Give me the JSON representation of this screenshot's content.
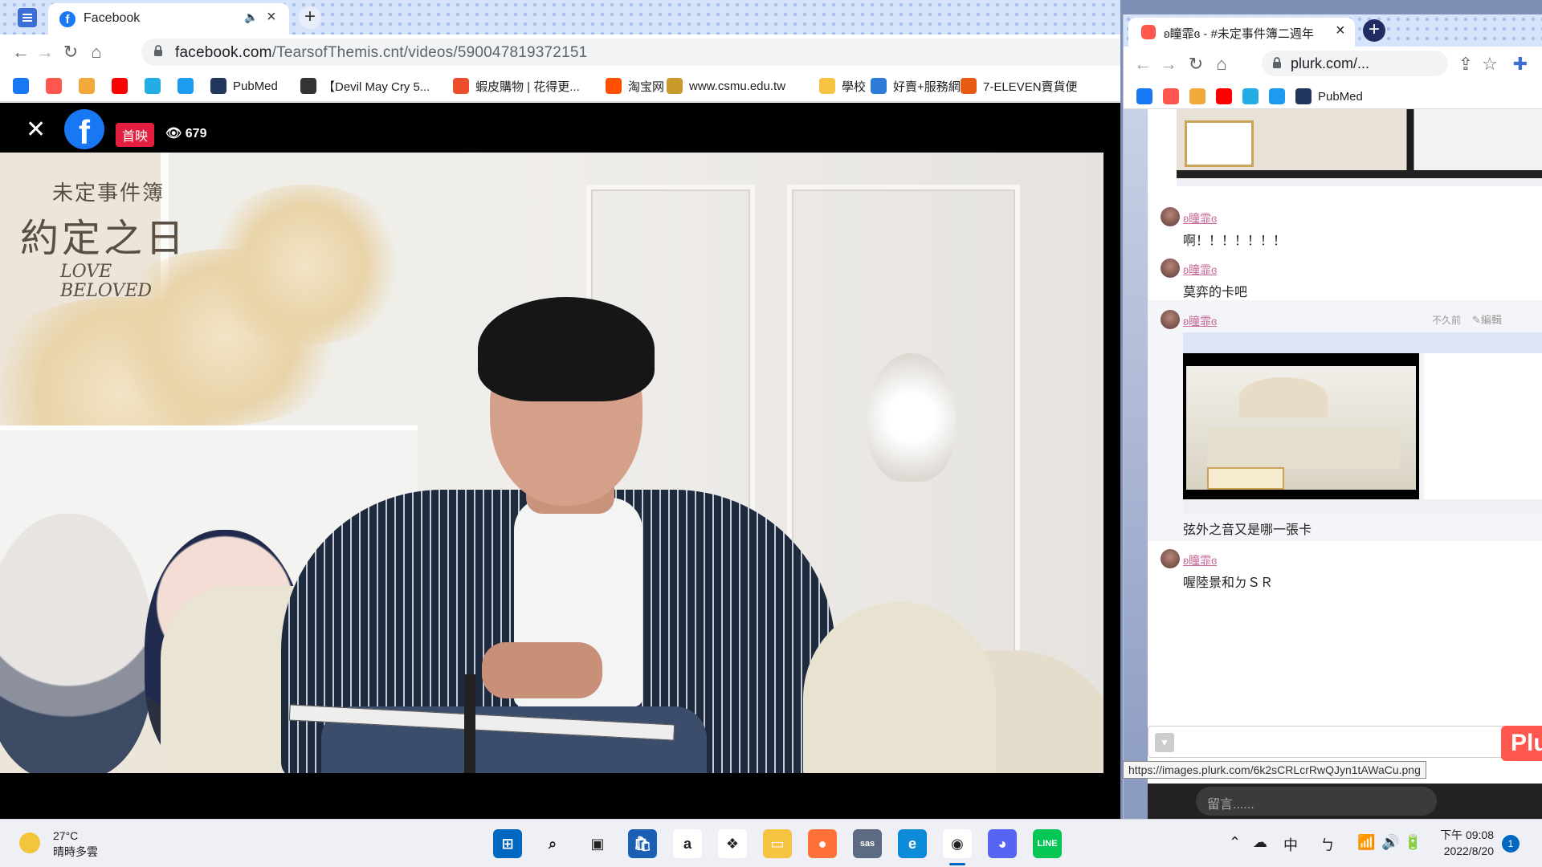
{
  "main_browser": {
    "tab": {
      "title": "Facebook"
    },
    "url": {
      "host": "facebook.com",
      "path": "/TearsofThemis.cnt/videos/590047819372151"
    },
    "bookmarks": [
      {
        "label": "",
        "icon": "facebook-icon",
        "color": "#1877f2"
      },
      {
        "label": "",
        "icon": "plurk-icon",
        "color": "#ff574d"
      },
      {
        "label": "",
        "icon": "orange-square-icon",
        "color": "#f2a93b"
      },
      {
        "label": "",
        "icon": "youtube-icon",
        "color": "#ff0000"
      },
      {
        "label": "",
        "icon": "bilibili-icon",
        "color": "#23ade5"
      },
      {
        "label": "",
        "icon": "twitter-icon",
        "color": "#1d9bf0"
      },
      {
        "label": "PubMed",
        "icon": "pubmed-icon",
        "color": "#20365c"
      },
      {
        "label": "【Devil May Cry 5...",
        "icon": "dmc-icon",
        "color": "#333333"
      },
      {
        "label": "蝦皮購物 | 花得更...",
        "icon": "shopee-icon",
        "color": "#ee4d2d"
      },
      {
        "label": "淘宝网",
        "icon": "taobao-icon",
        "color": "#ff5000"
      },
      {
        "label": "www.csmu.edu.tw",
        "icon": "csmu-icon",
        "color": "#c89a2c"
      },
      {
        "label": "學校",
        "icon": "folder-icon",
        "color": "#f6c342"
      },
      {
        "label": "好賣+服務網",
        "icon": "haomai-icon",
        "color": "#2f7bd8"
      },
      {
        "label": "7-ELEVEN賣貨便",
        "icon": "seven-eleven-icon",
        "color": "#e55b13"
      }
    ]
  },
  "facebook_viewer": {
    "premiere_badge": "首映",
    "views": "679",
    "video_overlay": {
      "title_small": "未定事件簿",
      "title_big": "約定之日",
      "title_en_1": "LOVE",
      "title_en_2": "BELOVED"
    }
  },
  "side_browser": {
    "tab": {
      "title": "ʚ瞳霏ɞ - #未定事件簿二週年"
    },
    "url": "plurk.com/...",
    "bookmarks": [
      {
        "label": "",
        "icon": "facebook-icon",
        "color": "#1877f2"
      },
      {
        "label": "",
        "icon": "plurk-icon",
        "color": "#ff574d"
      },
      {
        "label": "",
        "icon": "orange-square-icon",
        "color": "#f2a93b"
      },
      {
        "label": "",
        "icon": "youtube-icon",
        "color": "#ff0000"
      },
      {
        "label": "",
        "icon": "bilibili-icon",
        "color": "#23ade5"
      },
      {
        "label": "",
        "icon": "twitter-icon",
        "color": "#1d9bf0"
      },
      {
        "label": "PubMed",
        "icon": "pubmed-icon",
        "color": "#20365c"
      }
    ],
    "responses": [
      {
        "user": "ʚ瞳霏ɞ",
        "text": "啊！！！！！！！"
      },
      {
        "user": "ʚ瞳霏ɞ",
        "text": "莫弈的卡吧"
      },
      {
        "user": "ʚ瞳霏ɞ",
        "text": "弦外之音又是哪一張卡",
        "time": "不久前",
        "edit": "編輯"
      },
      {
        "user": "ʚ瞳霏ɞ",
        "text": "喔陸景和ㄉＳＲ"
      }
    ],
    "tooltip": "https://images.plurk.com/6k2sCRLcrRwQJyn1tAWaCu.png",
    "plurk_button": "Plu",
    "comment_placeholder": "留言......"
  },
  "taskbar": {
    "weather": {
      "temp": "27°C",
      "desc": "晴時多雲"
    },
    "apps": [
      {
        "name": "start",
        "color": "#0067c0",
        "glyph": "⊞"
      },
      {
        "name": "search",
        "color": "#eef0f6",
        "glyph": "⌕"
      },
      {
        "name": "task-view",
        "color": "#eef0f6",
        "glyph": "▣"
      },
      {
        "name": "store",
        "color": "#1a5fb4",
        "glyph": "🛍"
      },
      {
        "name": "amazon",
        "color": "#ffffff",
        "glyph": "a"
      },
      {
        "name": "dropbox",
        "color": "#ffffff",
        "glyph": "❖"
      },
      {
        "name": "file-explorer",
        "color": "#f6c342",
        "glyph": "▭"
      },
      {
        "name": "firefox",
        "color": "#ff7139",
        "glyph": "●"
      },
      {
        "name": "sas",
        "color": "#5d6b82",
        "glyph": "sas"
      },
      {
        "name": "edge",
        "color": "#0c8bd8",
        "glyph": "e"
      },
      {
        "name": "chrome",
        "color": "#ffffff",
        "glyph": "◉"
      },
      {
        "name": "discord",
        "color": "#5865f2",
        "glyph": "◕"
      },
      {
        "name": "line",
        "color": "#06c755",
        "glyph": "LINE"
      }
    ],
    "ime": "中",
    "time": "下午 09:08",
    "date": "2022/8/20",
    "notifications": "1"
  }
}
